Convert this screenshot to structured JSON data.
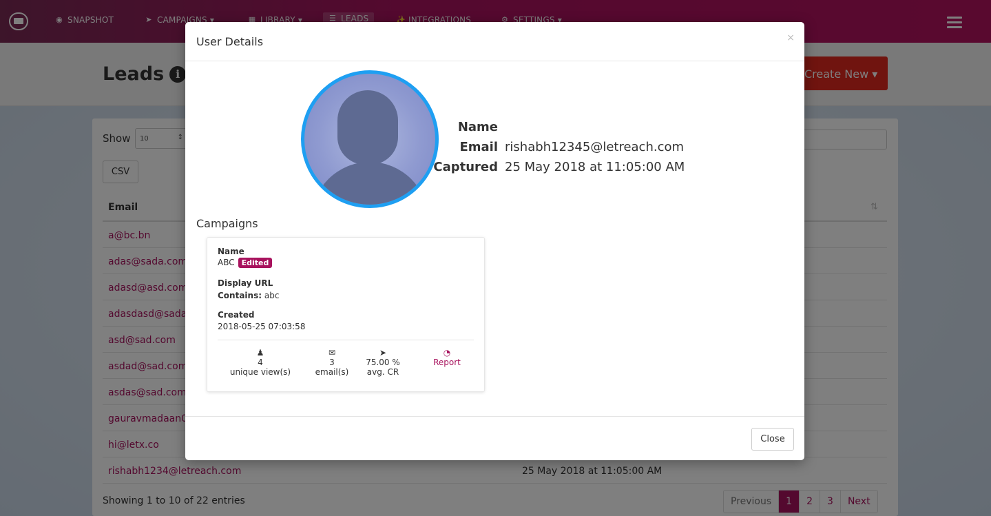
{
  "nav": {
    "items": [
      {
        "label": "SNAPSHOT",
        "icon": "dashboard-icon"
      },
      {
        "label": "CAMPAIGNS ▾",
        "icon": "paper-plane-icon"
      },
      {
        "label": "LIBRARY ▾",
        "icon": "book-icon"
      },
      {
        "label": "LEADS",
        "icon": "list-icon"
      },
      {
        "label": "INTEGRATIONS",
        "icon": "plug-icon"
      },
      {
        "label": "SETTINGS ▾",
        "icon": "gear-icon"
      }
    ],
    "brand_colors": {
      "from": "#7a2a55",
      "to": "#b3135f"
    }
  },
  "page": {
    "title": "Leads",
    "create_button": "Create New ▾",
    "show_label": "Show",
    "show_value": "10",
    "csv_label": "CSV",
    "table_header_email": "Email",
    "rows": [
      {
        "email": "a@bc.bn",
        "date": ""
      },
      {
        "email": "adas@sada.com",
        "date": ""
      },
      {
        "email": "adasd@asd.com",
        "date": ""
      },
      {
        "email": "adasdasd@sada",
        "date": ""
      },
      {
        "email": "asd@sad.com",
        "date": ""
      },
      {
        "email": "asdad@sad.com",
        "date": ""
      },
      {
        "email": "asdas@sad.com",
        "date": ""
      },
      {
        "email": "gauravmadaan0",
        "date": ""
      },
      {
        "email": "hi@letx.co",
        "date": ""
      },
      {
        "email": "rishabh1234@letreach.com",
        "date": "25 May 2018 at 11:05:00 AM"
      }
    ],
    "entries_info": "Showing 1 to 10 of 22 entries",
    "pager": {
      "previous": "Previous",
      "pages": [
        "1",
        "2",
        "3"
      ],
      "current": "1",
      "next": "Next"
    }
  },
  "modal": {
    "title": "User Details",
    "close_x": "×",
    "fields": {
      "name_label": "Name",
      "name_value": "",
      "email_label": "Email",
      "email_value": "rishabh12345@letreach.com",
      "captured_label": "Captured",
      "captured_value": "25 May 2018 at 11:05:00 AM"
    },
    "campaigns_heading": "Campaigns",
    "campaign": {
      "name_label": "Name",
      "name_value": "ABC",
      "badge": "Edited",
      "display_url_label": "Display URL",
      "contains_label": "Contains:",
      "contains_value": "abc",
      "created_label": "Created",
      "created_value": "2018-05-25 07:03:58",
      "stats": [
        {
          "icon": "users-icon",
          "value": "4",
          "label": "unique view(s)"
        },
        {
          "icon": "envelope-icon",
          "value": "3",
          "label": "email(s)"
        },
        {
          "icon": "cursor-icon",
          "value": "75.00 %",
          "label": "avg. CR"
        },
        {
          "icon": "pie-chart-icon",
          "value": "",
          "label": "Report"
        }
      ]
    },
    "close_button": "Close"
  }
}
